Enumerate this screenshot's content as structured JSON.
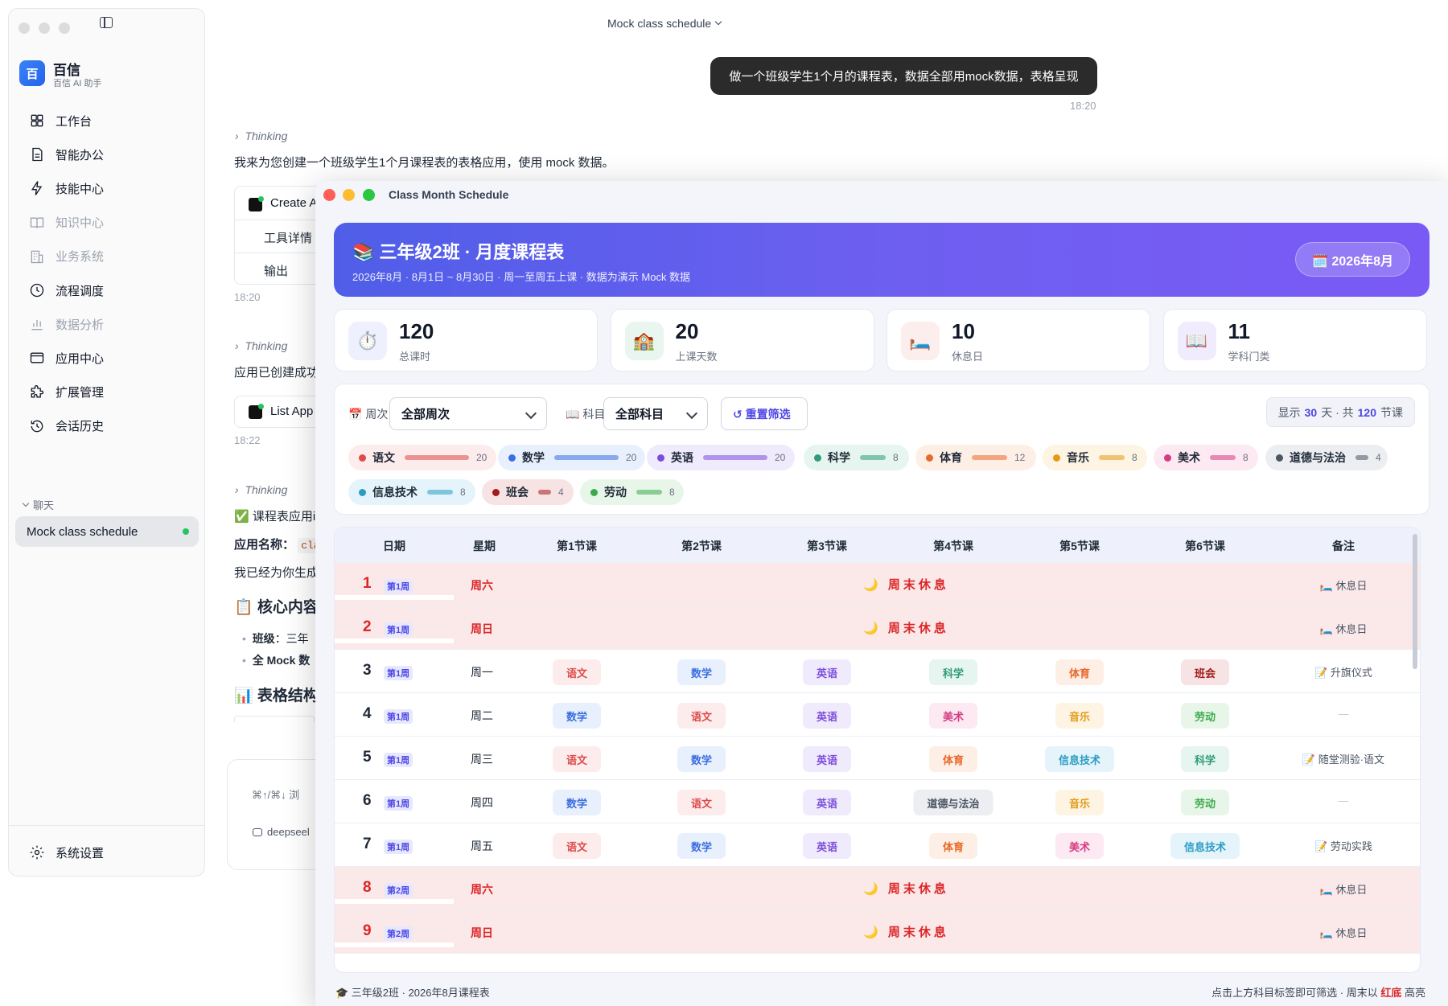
{
  "window": {
    "title": "Mock class schedule"
  },
  "sidebar": {
    "brand": {
      "logo_char": "百",
      "name": "百信",
      "subtitle": "百信 AI 助手"
    },
    "items": [
      {
        "label": "工作台",
        "icon": "grid-icon",
        "dim": false
      },
      {
        "label": "智能办公",
        "icon": "document-icon",
        "dim": false
      },
      {
        "label": "技能中心",
        "icon": "lightning-icon",
        "dim": false
      },
      {
        "label": "知识中心",
        "icon": "book-icon",
        "dim": true
      },
      {
        "label": "业务系统",
        "icon": "building-icon",
        "dim": true
      },
      {
        "label": "流程调度",
        "icon": "clock-icon",
        "dim": false
      },
      {
        "label": "数据分析",
        "icon": "bar-chart-icon",
        "dim": true
      },
      {
        "label": "应用中心",
        "icon": "browser-icon",
        "dim": false
      },
      {
        "label": "扩展管理",
        "icon": "puzzle-icon",
        "dim": false
      },
      {
        "label": "会话历史",
        "icon": "history-icon",
        "dim": false
      }
    ],
    "section_label": "聊天",
    "active_chat": "Mock class schedule",
    "settings_label": "系统设置"
  },
  "chat": {
    "user_message": "做一个班级学生1个月的课程表，数据全部用mock数据，表格呈现",
    "user_time": "18:20",
    "thinking_label": "Thinking",
    "reply_1": "我来为您创建一个班级学生1个月课程表的表格应用，使用 mock 数据。",
    "tool_1": {
      "title": "Create A",
      "row1": "工具详情",
      "row2": "输出"
    },
    "time_1": "18:20",
    "reply_2": "应用已创建成功",
    "tool_2": {
      "title": "List App"
    },
    "time_2": "18:22",
    "reply_3": "✅ 课程表应用i",
    "app_name_label": "应用名称：",
    "app_name_code": "cla",
    "reply_4": "我已经为你生成",
    "heading_1": "📋 核心内容",
    "bullet_1_bold": "班级",
    "bullet_1_rest": "：三年",
    "bullet_2": "全 Mock 数",
    "heading_2": "📊 表格结构",
    "input_hint": "⌘↑/⌘↓ 浏",
    "model_label": "deepseel"
  },
  "schedule": {
    "window_title": "Class Month Schedule",
    "hero": {
      "title": "📚 三年级2班 · 月度课程表",
      "subtitle": "2026年8月 · 8月1日 ~ 8月30日 · 周一至周五上课 · 数据为演示 Mock 数据",
      "badge": "🗓️ 2026年8月"
    },
    "stats": [
      {
        "icon": "⏱️",
        "value": "120",
        "label": "总课时",
        "bg": "#eef0fd"
      },
      {
        "icon": "🏫",
        "value": "20",
        "label": "上课天数",
        "bg": "#e8f6ef"
      },
      {
        "icon": "🛏️",
        "value": "10",
        "label": "休息日",
        "bg": "#fdeeee"
      },
      {
        "icon": "📖",
        "value": "11",
        "label": "学科门类",
        "bg": "#f1ecfd"
      }
    ],
    "filters": {
      "week_label": "📅 周次",
      "week_value": "全部周次",
      "subject_label": "📖 科目",
      "subject_value": "全部科目",
      "reset_label": "↺ 重置筛选",
      "summary_prefix": "显示",
      "summary_days": "30",
      "summary_mid": "天 · 共",
      "summary_lessons": "120",
      "summary_suffix": "节课"
    },
    "subjects": [
      {
        "name": "语文",
        "count": "20",
        "color": "#dc4a4a",
        "bg": "#fdecec"
      },
      {
        "name": "数学",
        "count": "20",
        "color": "#3b6fe0",
        "bg": "#e9f0fd"
      },
      {
        "name": "英语",
        "count": "20",
        "color": "#7c4ddb",
        "bg": "#f0eafd"
      },
      {
        "name": "科学",
        "count": "8",
        "color": "#2e9c7a",
        "bg": "#e6f5ef"
      },
      {
        "name": "体育",
        "count": "12",
        "color": "#e8692a",
        "bg": "#fdefe6"
      },
      {
        "name": "音乐",
        "count": "8",
        "color": "#e49a16",
        "bg": "#fdf4e3"
      },
      {
        "name": "美术",
        "count": "8",
        "color": "#d63b84",
        "bg": "#fce9f2"
      },
      {
        "name": "道德与法治",
        "count": "4",
        "color": "#4b5563",
        "bg": "#eceef1"
      },
      {
        "name": "信息技术",
        "count": "8",
        "color": "#2b9cc4",
        "bg": "#e5f4fa"
      },
      {
        "name": "班会",
        "count": "4",
        "color": "#a01c1c",
        "bg": "#f7e3e3"
      },
      {
        "name": "劳动",
        "count": "8",
        "color": "#3bab4a",
        "bg": "#e8f6ea"
      }
    ],
    "columns": [
      "日期",
      "星期",
      "第1节课",
      "第2节课",
      "第3节课",
      "第4节课",
      "第5节课",
      "第6节课",
      "备注"
    ],
    "rest_text": "🌙 周末休息",
    "rows": [
      {
        "day": "1",
        "week": "第1周",
        "dow": "周六",
        "weekend": true,
        "lessons": [],
        "note": "🛏️ 休息日"
      },
      {
        "day": "2",
        "week": "第1周",
        "dow": "周日",
        "weekend": true,
        "lessons": [],
        "note": "🛏️ 休息日"
      },
      {
        "day": "3",
        "week": "第1周",
        "dow": "周一",
        "weekend": false,
        "lessons": [
          "语文",
          "数学",
          "英语",
          "科学",
          "体育",
          "班会"
        ],
        "note": "📝 升旗仪式"
      },
      {
        "day": "4",
        "week": "第1周",
        "dow": "周二",
        "weekend": false,
        "lessons": [
          "数学",
          "语文",
          "英语",
          "美术",
          "音乐",
          "劳动"
        ],
        "note": "—"
      },
      {
        "day": "5",
        "week": "第1周",
        "dow": "周三",
        "weekend": false,
        "lessons": [
          "语文",
          "数学",
          "英语",
          "体育",
          "信息技术",
          "科学"
        ],
        "note": "📝 随堂测验·语文"
      },
      {
        "day": "6",
        "week": "第1周",
        "dow": "周四",
        "weekend": false,
        "lessons": [
          "数学",
          "语文",
          "英语",
          "道德与法治",
          "音乐",
          "劳动"
        ],
        "note": "—"
      },
      {
        "day": "7",
        "week": "第1周",
        "dow": "周五",
        "weekend": false,
        "lessons": [
          "语文",
          "数学",
          "英语",
          "体育",
          "美术",
          "信息技术"
        ],
        "note": "📝 劳动实践"
      },
      {
        "day": "8",
        "week": "第2周",
        "dow": "周六",
        "weekend": true,
        "lessons": [],
        "note": "🛏️ 休息日"
      },
      {
        "day": "9",
        "week": "第2周",
        "dow": "周日",
        "weekend": true,
        "lessons": [],
        "note": "🛏️ 休息日"
      }
    ],
    "footer": {
      "left": "🎓 三年级2班 · 2026年8月课程表",
      "right_prefix": "点击上方科目标签即可筛选 · 周末以",
      "right_red": "红底",
      "right_suffix": "高亮"
    }
  }
}
